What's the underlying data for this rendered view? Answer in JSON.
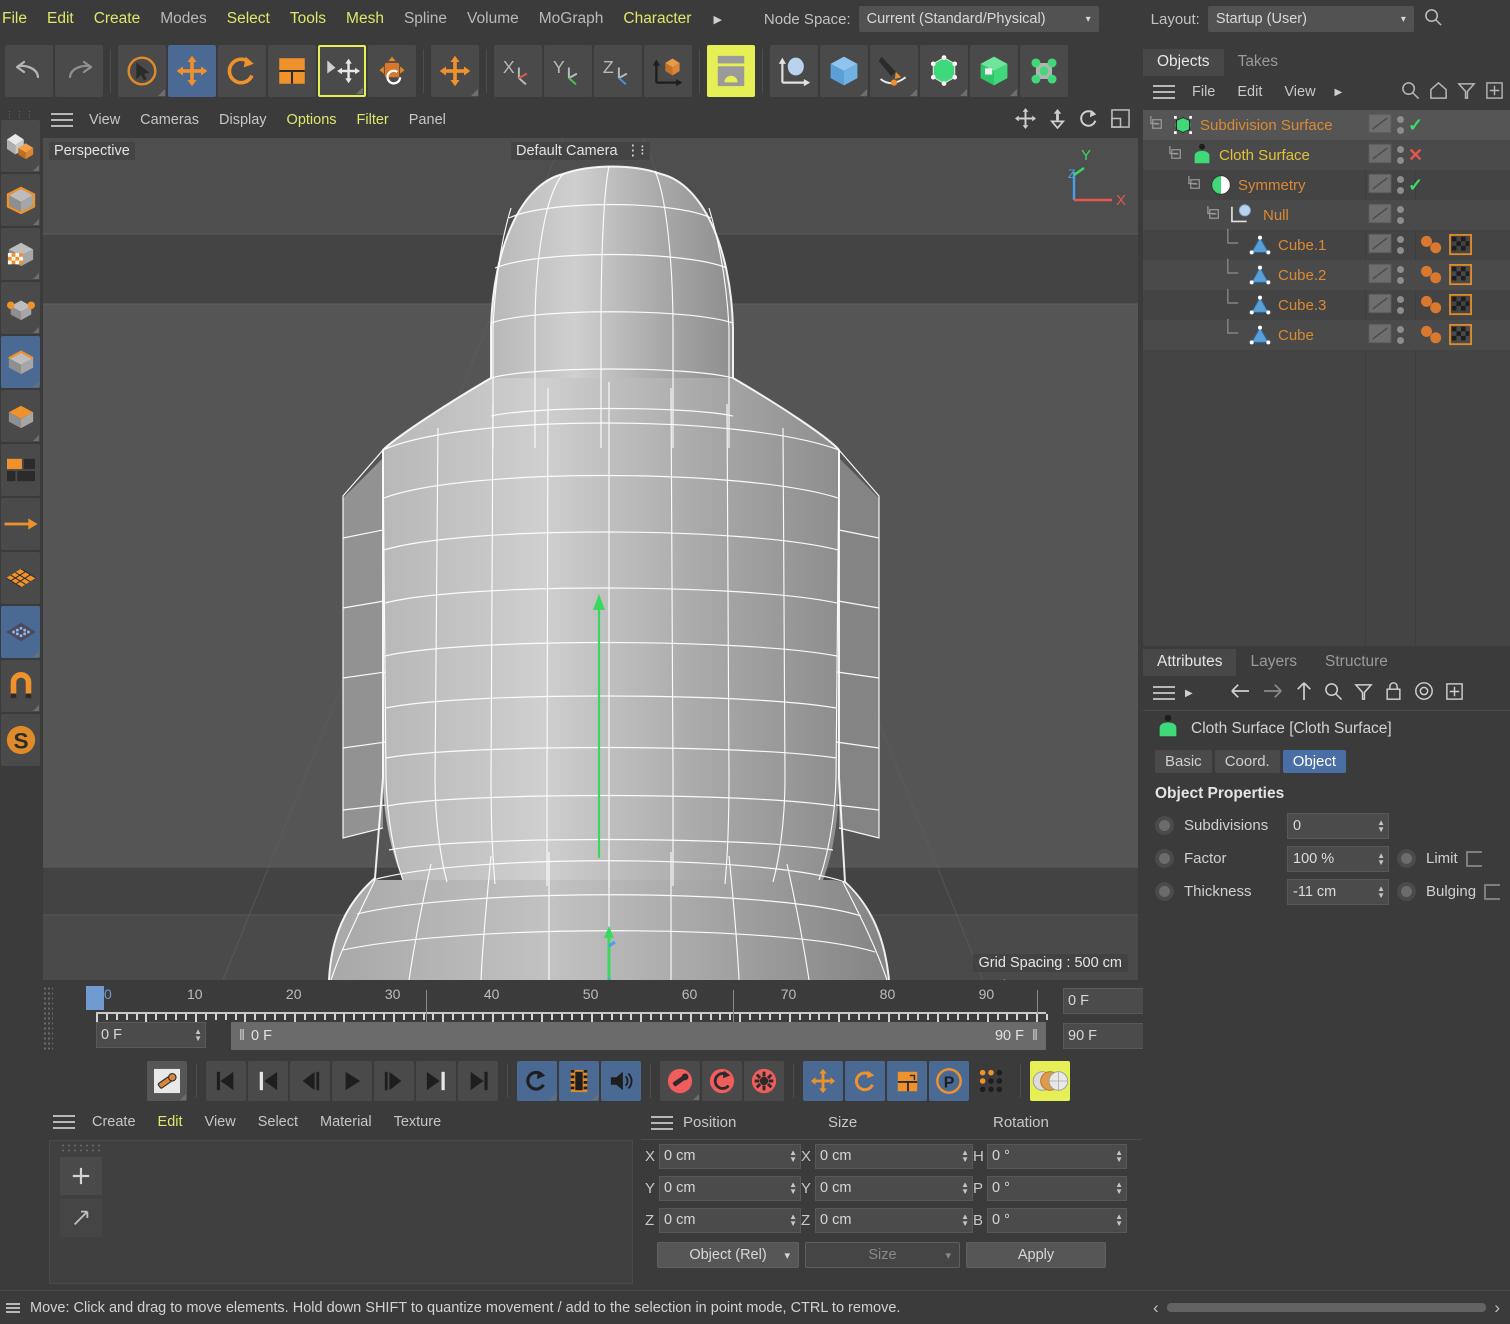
{
  "menubar": {
    "items": [
      {
        "label": "File",
        "hl": true
      },
      {
        "label": "Edit",
        "hl": true
      },
      {
        "label": "Create",
        "hl": true
      },
      {
        "label": "Modes",
        "hl": false
      },
      {
        "label": "Select",
        "hl": true
      },
      {
        "label": "Tools",
        "hl": true
      },
      {
        "label": "Mesh",
        "hl": true
      },
      {
        "label": "Spline",
        "hl": false
      },
      {
        "label": "Volume",
        "hl": false
      },
      {
        "label": "MoGraph",
        "hl": false
      },
      {
        "label": "Character",
        "hl": true
      }
    ],
    "overflow_arrow": "▶",
    "node_space_label": "Node Space:",
    "node_space_value": "Current (Standard/Physical)",
    "layout_label": "Layout:",
    "layout_value": "Startup (User)",
    "search_icon": "search-icon"
  },
  "toolbar": {
    "undo": "undo-icon",
    "redo": "redo-icon",
    "live_selection": "live-selection-tool",
    "move": "move-tool",
    "rotate": "rotate-tool",
    "scale": "scale-tool",
    "workplane": "move-workplane-tool",
    "axis_tool": "axis-modification-tool",
    "world_move": "world-move-tool",
    "lock_x": "lock-x-axis",
    "lock_y": "lock-y-axis",
    "lock_z": "lock-z-axis",
    "world_object": "world-object-coordinates",
    "render_view": "render-view-button",
    "null_object": "null-object-button",
    "cube_primitive": "cube-primitive-button",
    "spline_pen": "spline-pen-button",
    "subdivision_surface": "subdivision-surface-button",
    "bend_deformer": "deformer-button",
    "mograph_cloner": "mograph-cloner-button"
  },
  "left_toolbar": {
    "items": [
      {
        "name": "model-mode",
        "selected": false
      },
      {
        "name": "object-mode",
        "selected": false
      },
      {
        "name": "texture-mode",
        "selected": false
      },
      {
        "name": "points-mode",
        "selected": false
      },
      {
        "name": "edges-mode",
        "selected": true
      },
      {
        "name": "polygons-mode",
        "selected": false
      },
      {
        "name": "viewport-layout",
        "selected": false
      },
      {
        "name": "enable-axis-modification",
        "selected": false
      },
      {
        "name": "enable-snapping",
        "selected": false
      },
      {
        "name": "workplane-snap",
        "selected": true
      },
      {
        "name": "magnet-tool",
        "selected": false
      },
      {
        "name": "scene-nodes",
        "selected": false
      }
    ]
  },
  "viewport": {
    "menu": [
      {
        "label": "View",
        "hl": false
      },
      {
        "label": "Cameras",
        "hl": false
      },
      {
        "label": "Display",
        "hl": false
      },
      {
        "label": "Options",
        "hl": true
      },
      {
        "label": "Filter",
        "hl": true
      },
      {
        "label": "Panel",
        "hl": false
      }
    ],
    "corner_label": "Perspective",
    "camera_label": "Default Camera",
    "grid_spacing": "Grid Spacing : 500 cm",
    "axis_x": "X",
    "axis_y": "Y",
    "axis_z": "Z",
    "right_icons": [
      "pan-icon",
      "move-vertical-icon",
      "rotate-icon",
      "maximize-icon"
    ]
  },
  "timeline": {
    "ticks": [
      "0",
      "10",
      "20",
      "30",
      "40",
      "50",
      "60",
      "70",
      "80",
      "90"
    ],
    "playhead_frame": "0",
    "current_frame_field": "0 F",
    "preview_min": "0 F",
    "preview_max": "90 F",
    "start_field": "0 F",
    "end_field": "90 F"
  },
  "playbar": {
    "autokey": "record-active-objects",
    "transport": [
      {
        "name": "go-to-start"
      },
      {
        "name": "go-to-previous-key"
      },
      {
        "name": "step-back"
      },
      {
        "name": "play-forward"
      },
      {
        "name": "step-forward"
      },
      {
        "name": "go-to-next-key"
      },
      {
        "name": "go-to-end"
      }
    ],
    "loop": "loop-playback",
    "film": "play-in-preview-range",
    "sound": "sound-toggle",
    "record": "record-active-objects-button",
    "autokeying": "autokeying-button",
    "keyframe-settings": "keyframe-selection-settings",
    "pos_key": "position-key",
    "rot_key": "rotation-key",
    "scale_key": "scale-key",
    "param_key": "parameter-key",
    "point_key": "point-level-animation",
    "material": "material-preview"
  },
  "material_manager": {
    "menu": [
      {
        "label": "Create",
        "hl": false
      },
      {
        "label": "Edit",
        "hl": true
      },
      {
        "label": "View",
        "hl": false
      },
      {
        "label": "Select",
        "hl": false
      },
      {
        "label": "Material",
        "hl": false
      },
      {
        "label": "Texture",
        "hl": false
      }
    ],
    "add_icon": "plus-icon",
    "arrow_icon": "diagonal-arrow-icon"
  },
  "coordinates": {
    "col_position": "Position",
    "col_size": "Size",
    "col_rotation": "Rotation",
    "rows": [
      {
        "p_axis": "X",
        "p_val": "0 cm",
        "s_axis": "X",
        "s_val": "0 cm",
        "r_axis": "H",
        "r_val": "0 °"
      },
      {
        "p_axis": "Y",
        "p_val": "0 cm",
        "s_axis": "Y",
        "s_val": "0 cm",
        "r_axis": "P",
        "r_val": "0 °"
      },
      {
        "p_axis": "Z",
        "p_val": "0 cm",
        "s_axis": "Z",
        "s_val": "0 cm",
        "r_axis": "B",
        "r_val": "0 °"
      }
    ],
    "mode_dropdown": "Object (Rel)",
    "size_dropdown": "Size",
    "apply_button": "Apply"
  },
  "object_manager": {
    "tabs": [
      {
        "label": "Objects",
        "active": true
      },
      {
        "label": "Takes",
        "active": false
      }
    ],
    "menu": [
      {
        "label": "File"
      },
      {
        "label": "Edit"
      },
      {
        "label": "View"
      }
    ],
    "menu_arrow": "▶",
    "tool_icons": [
      "search-icon",
      "home-icon",
      "filter-icon",
      "plus-box-icon"
    ],
    "rows": [
      {
        "name": "Subdivision Surface",
        "depth": 0,
        "icon": "subdivision-surface-icon",
        "state": "check",
        "selected": true,
        "color": "orange",
        "materials": false,
        "expander": true
      },
      {
        "name": "Cloth Surface",
        "depth": 1,
        "icon": "cloth-surface-icon",
        "state": "cross",
        "selected": false,
        "color": "yellow",
        "materials": false,
        "expander": true
      },
      {
        "name": "Symmetry",
        "depth": 2,
        "icon": "symmetry-icon",
        "state": "check",
        "selected": false,
        "color": "orange",
        "materials": false,
        "expander": true
      },
      {
        "name": "Null",
        "depth": 3,
        "icon": "null-icon",
        "state": "none",
        "selected": false,
        "color": "orange",
        "materials": false,
        "expander": true
      },
      {
        "name": "Cube.1",
        "depth": 4,
        "icon": "polygon-object-icon",
        "state": "none",
        "selected": false,
        "color": "orange",
        "materials": true,
        "expander": false
      },
      {
        "name": "Cube.2",
        "depth": 4,
        "icon": "polygon-object-icon",
        "state": "none",
        "selected": false,
        "color": "orange",
        "materials": true,
        "expander": false
      },
      {
        "name": "Cube.3",
        "depth": 4,
        "icon": "polygon-object-icon",
        "state": "none",
        "selected": false,
        "color": "orange",
        "materials": true,
        "expander": false
      },
      {
        "name": "Cube",
        "depth": 4,
        "icon": "polygon-object-icon",
        "state": "none",
        "selected": false,
        "color": "orange",
        "materials": true,
        "expander": false
      }
    ]
  },
  "attributes": {
    "tabs": [
      {
        "label": "Attributes",
        "active": true
      },
      {
        "label": "Layers",
        "active": false
      },
      {
        "label": "Structure",
        "active": false
      }
    ],
    "tool_icons": [
      "hamburger-icon",
      "arrow-right-small-icon",
      "back-arrow-icon",
      "forward-arrow-icon",
      "up-arrow-icon",
      "search-icon",
      "filter-icon",
      "lock-icon",
      "target-icon",
      "plus-box-icon"
    ],
    "object_title": "Cloth Surface [Cloth Surface]",
    "object_icon": "cloth-surface-icon",
    "prop_tabs": [
      {
        "label": "Basic",
        "active": false
      },
      {
        "label": "Coord.",
        "active": false
      },
      {
        "label": "Object",
        "active": true
      }
    ],
    "section_title": "Object Properties",
    "properties": [
      {
        "label": "Subdivisions",
        "value": "0",
        "extra_label": null
      },
      {
        "label": "Factor",
        "value": "100 %",
        "extra_label": "Limit"
      },
      {
        "label": "Thickness",
        "value": "-11 cm",
        "extra_label": "Bulging"
      }
    ]
  },
  "statusbar": {
    "message": "Move: Click and drag to move elements. Hold down SHIFT to quantize movement / add to the selection in point mode, CTRL to remove.",
    "hamburger": "hamburger-icon",
    "scroll_left": "‹",
    "scroll_right": "›"
  },
  "colors": {
    "bg": "#3b3b3b",
    "panel": "#444444",
    "accent_orange": "#d98a34",
    "accent_yellow": "#e3c13c",
    "menu_yellow": "#dfe86a",
    "selection_blue": "#4a6a94",
    "tab_blue": "#4a6fa5",
    "green_check": "#3ddc6a",
    "red_cross": "#e2564e",
    "viewport_bg": "#525252",
    "highlight_yellow": "#e6ef56"
  }
}
